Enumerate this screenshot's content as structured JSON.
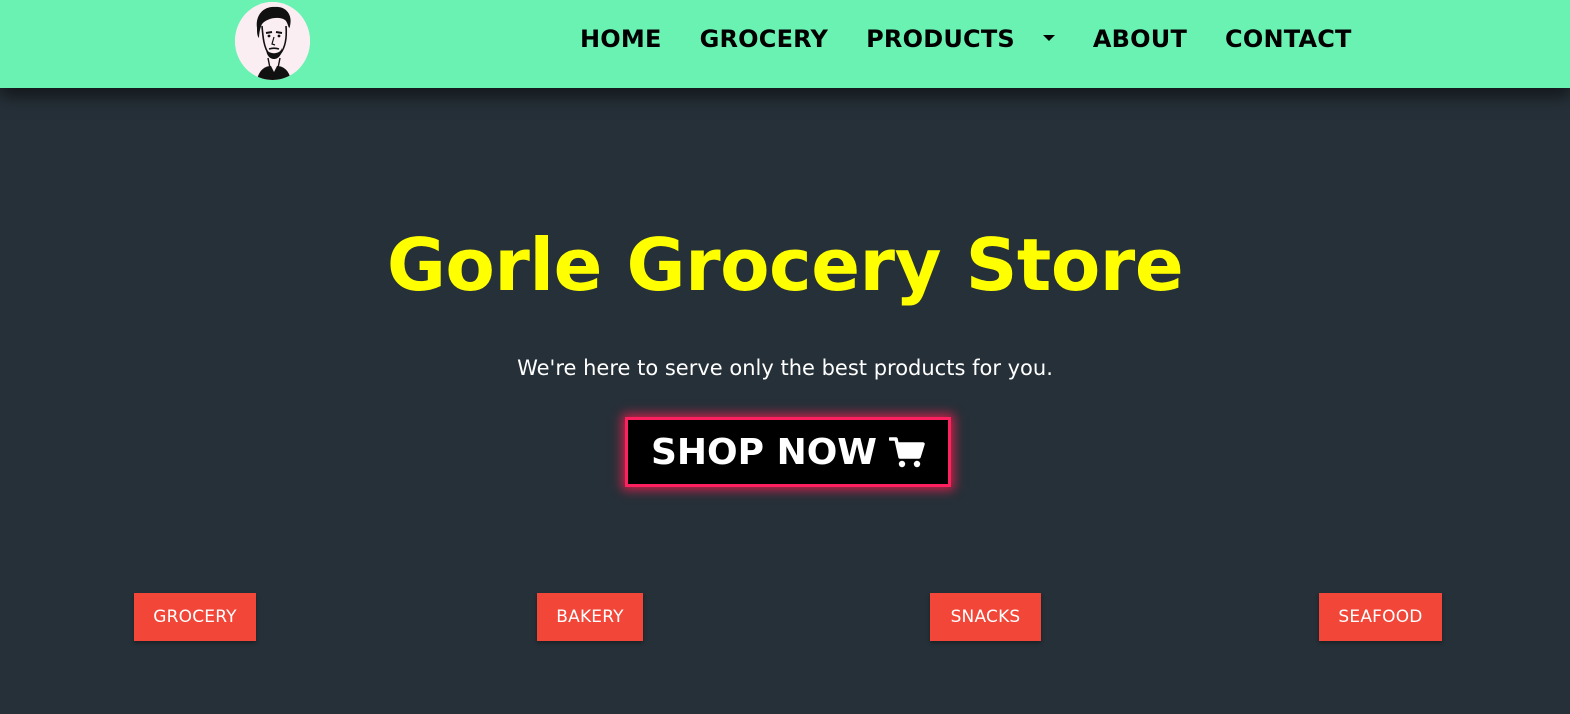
{
  "navbar": {
    "logo_icon": "portrait-logo-icon",
    "links": {
      "home": "HOME",
      "grocery": "GROCERY",
      "products": "PRODUCTS",
      "about": "ABOUT",
      "contact": "CONTACT"
    },
    "background_color": "#6af2b3"
  },
  "hero": {
    "title": "Gorle Grocery Store",
    "subtitle": "We're here to serve only the best products for you.",
    "cta_label": "SHOP NOW",
    "cta_icon": "shopping-cart-icon",
    "title_color": "#ffff00",
    "cta_glow_color": "#ff2060"
  },
  "categories": {
    "items": [
      "GROCERY",
      "BAKERY",
      "SNACKS",
      "SEAFOOD"
    ],
    "button_color": "#f24638"
  },
  "page": {
    "background_color": "#263038"
  }
}
